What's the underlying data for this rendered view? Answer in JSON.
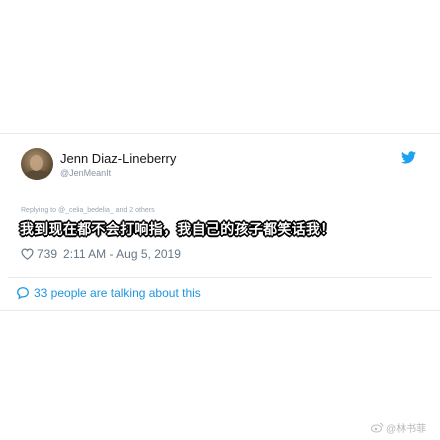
{
  "tweet": {
    "author": {
      "display_name": "Jenn Diaz-Lineberry",
      "handle": "@JenMeanIt"
    },
    "replying_to": {
      "prefix": "Replying to ",
      "mention": "@_celia_bedelia_",
      "suffix": " and 2 others"
    },
    "text": "我到现在都不会打响指，我自己的孩子都笑话我！",
    "likes": "739",
    "timestamp": "2:11 AM - Aug 5, 2019"
  },
  "conversation": {
    "label": "33 people are talking about this"
  },
  "watermark": {
    "text": "@林书菲"
  },
  "colors": {
    "twitter_blue": "#1da1f2",
    "link_blue": "#1b95e0",
    "meta_gray": "#657786",
    "divider": "#e6ecf0"
  },
  "icons": [
    "twitter-logo-icon",
    "heart-icon",
    "speech-bubble-icon",
    "weibo-icon"
  ]
}
